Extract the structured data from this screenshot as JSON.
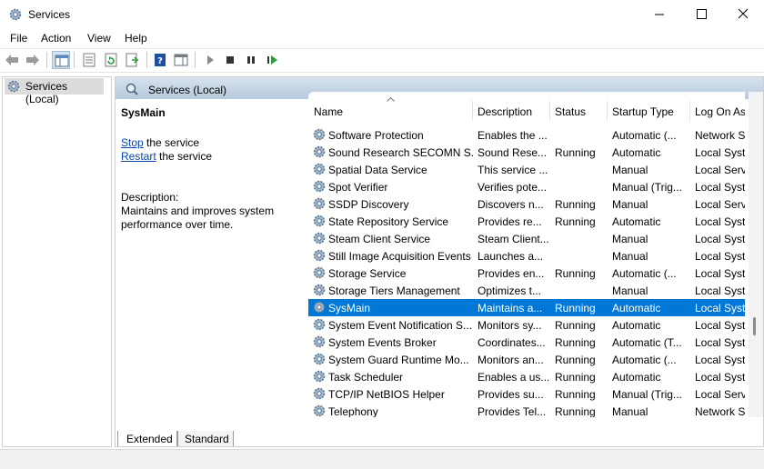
{
  "window": {
    "title": "Services",
    "icon": "gear-icon",
    "controls": [
      "minimize-icon",
      "maximize-icon",
      "close-icon"
    ]
  },
  "menu": [
    "File",
    "Action",
    "View",
    "Help"
  ],
  "toolbar": [
    "back-icon",
    "forward-icon",
    "show-hide-tree-icon",
    "properties-icon",
    "refresh-icon",
    "export-list-icon",
    "help-icon",
    "show-action-pane-icon",
    "start-icon",
    "stop-icon",
    "pause-icon",
    "restart-icon"
  ],
  "tree": {
    "label": "Services (Local)"
  },
  "pane": {
    "header": "Services (Local)",
    "selected_service": "SysMain",
    "stop_link": "Stop",
    "stop_suffix": " the service",
    "restart_link": "Restart",
    "restart_suffix": " the service",
    "description_label": "Description:",
    "description": "Maintains and improves system performance over time."
  },
  "columns": [
    "Name",
    "Description",
    "Status",
    "Startup Type",
    "Log On As"
  ],
  "services": [
    {
      "name": "Software Protection",
      "description": "Enables the ...",
      "status": "",
      "startup": "Automatic (...",
      "logon": "Network S..."
    },
    {
      "name": "Sound Research SECOMN S...",
      "description": "Sound Rese...",
      "status": "Running",
      "startup": "Automatic",
      "logon": "Local Syste..."
    },
    {
      "name": "Spatial Data Service",
      "description": "This service ...",
      "status": "",
      "startup": "Manual",
      "logon": "Local Servi..."
    },
    {
      "name": "Spot Verifier",
      "description": "Verifies pote...",
      "status": "",
      "startup": "Manual (Trig...",
      "logon": "Local Syste..."
    },
    {
      "name": "SSDP Discovery",
      "description": "Discovers n...",
      "status": "Running",
      "startup": "Manual",
      "logon": "Local Servi..."
    },
    {
      "name": "State Repository Service",
      "description": "Provides re...",
      "status": "Running",
      "startup": "Automatic",
      "logon": "Local Syste..."
    },
    {
      "name": "Steam Client Service",
      "description": "Steam Client...",
      "status": "",
      "startup": "Manual",
      "logon": "Local Syste..."
    },
    {
      "name": "Still Image Acquisition Events",
      "description": "Launches a...",
      "status": "",
      "startup": "Manual",
      "logon": "Local Syste..."
    },
    {
      "name": "Storage Service",
      "description": "Provides en...",
      "status": "Running",
      "startup": "Automatic (...",
      "logon": "Local Syste..."
    },
    {
      "name": "Storage Tiers Management",
      "description": "Optimizes t...",
      "status": "",
      "startup": "Manual",
      "logon": "Local Syste..."
    },
    {
      "name": "SysMain",
      "description": "Maintains a...",
      "status": "Running",
      "startup": "Automatic",
      "logon": "Local Syste...",
      "selected": true
    },
    {
      "name": "System Event Notification S...",
      "description": "Monitors sy...",
      "status": "Running",
      "startup": "Automatic",
      "logon": "Local Syste..."
    },
    {
      "name": "System Events Broker",
      "description": "Coordinates...",
      "status": "Running",
      "startup": "Automatic (T...",
      "logon": "Local Syste..."
    },
    {
      "name": "System Guard Runtime Mo...",
      "description": "Monitors an...",
      "status": "Running",
      "startup": "Automatic (...",
      "logon": "Local Syste..."
    },
    {
      "name": "Task Scheduler",
      "description": "Enables a us...",
      "status": "Running",
      "startup": "Automatic",
      "logon": "Local Syste..."
    },
    {
      "name": "TCP/IP NetBIOS Helper",
      "description": "Provides su...",
      "status": "Running",
      "startup": "Manual (Trig...",
      "logon": "Local Servi..."
    },
    {
      "name": "Telephony",
      "description": "Provides Tel...",
      "status": "Running",
      "startup": "Manual",
      "logon": "Network S..."
    }
  ],
  "tabs": [
    "Extended",
    "Standard"
  ],
  "colors": {
    "selection": "#0078d7",
    "header_gradient_top": "#d6e2ee",
    "header_gradient_bottom": "#b8cadd",
    "link": "#0645ad"
  }
}
